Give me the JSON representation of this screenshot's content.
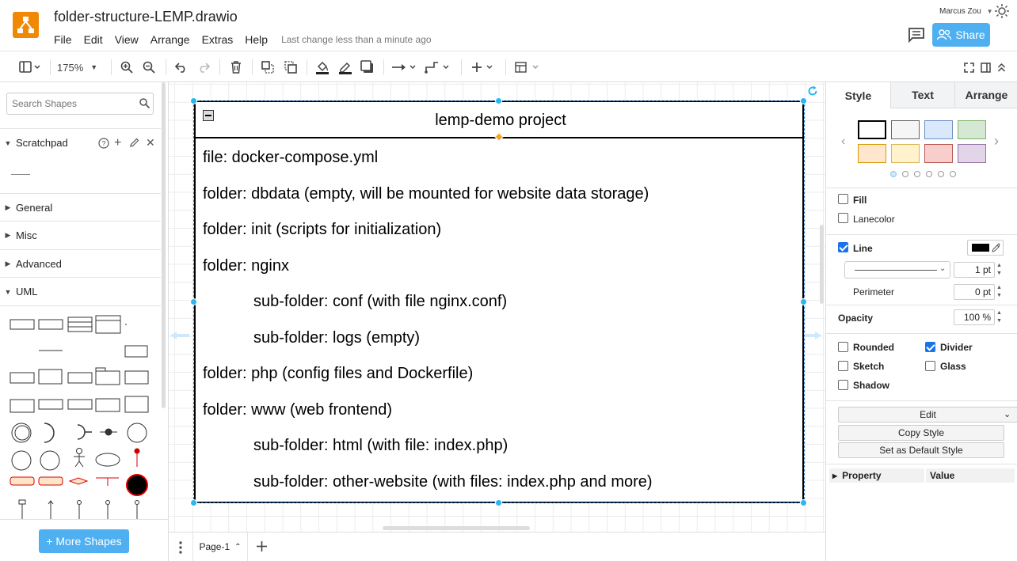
{
  "app": {
    "document_title": "folder-structure-LEMP.drawio",
    "menus": [
      "File",
      "Edit",
      "View",
      "Arrange",
      "Extras",
      "Help"
    ],
    "last_change": "Last change less than a minute ago",
    "user_name": "Marcus Zou",
    "share_label": "Share",
    "accent_color": "#4fb0f1",
    "logo_color": "#f08705"
  },
  "toolbar": {
    "zoom": "175%"
  },
  "sidebar": {
    "search_placeholder": "Search Shapes",
    "sections": [
      {
        "label": "Scratchpad",
        "expanded": true
      },
      {
        "label": "General",
        "expanded": false
      },
      {
        "label": "Misc",
        "expanded": false
      },
      {
        "label": "Advanced",
        "expanded": false
      },
      {
        "label": "UML",
        "expanded": true
      }
    ],
    "more_shapes_label": "+ More Shapes"
  },
  "diagram": {
    "container_title": "lemp-demo project",
    "lines": [
      "file: docker-compose.yml",
      "folder: dbdata (empty, will be mounted for website data storage)",
      "folder: init (scripts for initialization)",
      "folder: nginx",
      "sub-folder: conf (with file nginx.conf)",
      "sub-folder: logs (empty)",
      "folder: php (config files and Dockerfile)",
      "folder: www (web frontend)",
      "sub-folder: html (with file: index.php)",
      "sub-folder: other-website (with files: index.php and more)"
    ]
  },
  "pages": {
    "current_page": "Page-1"
  },
  "format_panel": {
    "tabs": [
      "Style",
      "Text",
      "Arrange"
    ],
    "active_tab": "Style",
    "swatch_colors": [
      "#ffffff",
      "#f5f5f5",
      "#dae8fc",
      "#d5e8d4",
      "#ffe6cc",
      "#fff2cc",
      "#f8cecc",
      "#e1d5e7"
    ],
    "swatch_borders": [
      "#000000",
      "#666666",
      "#6c8ebf",
      "#82b366",
      "#d79b00",
      "#d6b656",
      "#b85450",
      "#9673a6"
    ],
    "fill_label": "Fill",
    "lanecolor_label": "Lanecolor",
    "line_label": "Line",
    "line_width": "1 pt",
    "perimeter_label": "Perimeter",
    "perimeter_value": "0 pt",
    "opacity_label": "Opacity",
    "opacity_value": "100 %",
    "rounded_label": "Rounded",
    "divider_label": "Divider",
    "sketch_label": "Sketch",
    "glass_label": "Glass",
    "shadow_label": "Shadow",
    "edit_label": "Edit",
    "copy_style_label": "Copy Style",
    "set_default_label": "Set as Default Style",
    "property_header": "Property",
    "value_header": "Value",
    "fill_checked": false,
    "lanecolor_checked": false,
    "line_checked": true,
    "rounded_checked": false,
    "divider_checked": true,
    "sketch_checked": false,
    "glass_checked": false,
    "shadow_checked": false
  }
}
